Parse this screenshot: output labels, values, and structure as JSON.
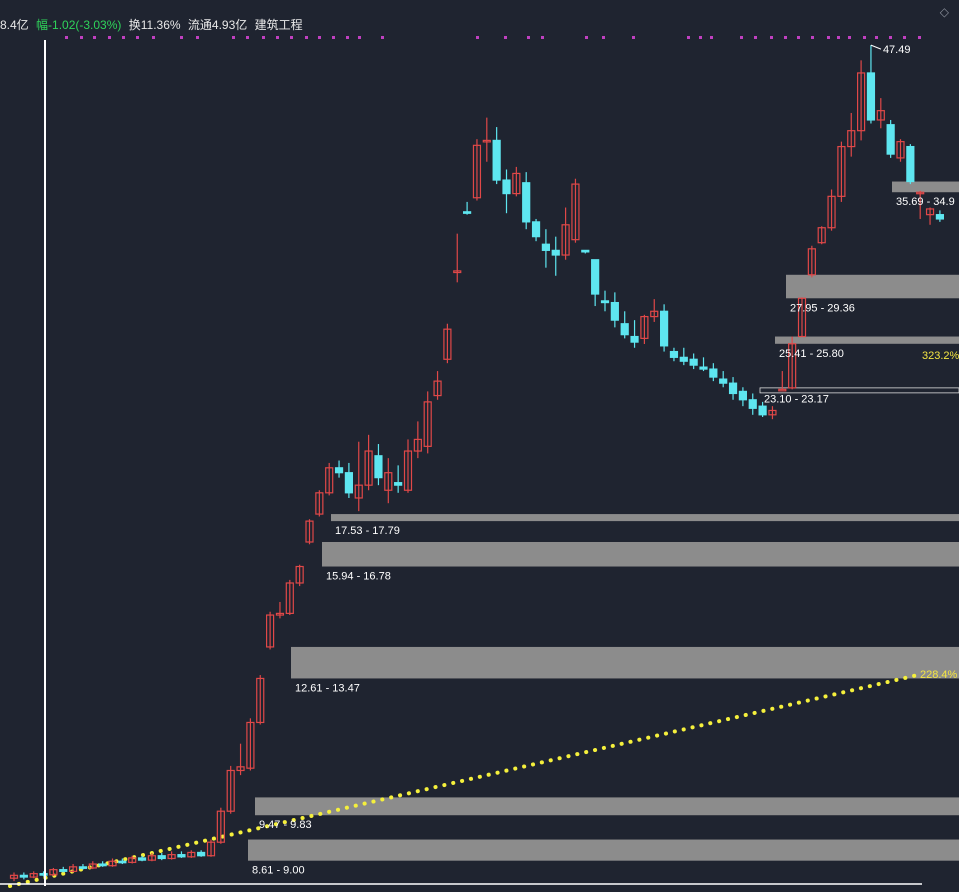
{
  "header": {
    "amount": "8.4亿",
    "change": "幅-1.02(-3.03%)",
    "turnover": "换11.36%",
    "float_cap": "流通4.93亿",
    "sector": "建筑工程",
    "change_color": "#2fd35a",
    "corner_icon": "diamond-icon"
  },
  "chart_data": {
    "type": "candlestick",
    "colors": {
      "up": "#e04848",
      "down": "#5ee6f0",
      "zone": "#8c8c8c",
      "trend": "#f5f03c",
      "marker": "#c040c0"
    },
    "y_log": true,
    "peak_label": "47.49",
    "zones": [
      {
        "label": "8.61 - 9.00",
        "low": 8.61,
        "high": 9.0
      },
      {
        "label": "9.47 - 9.83",
        "low": 9.47,
        "high": 9.83
      },
      {
        "label": "12.61 - 13.47",
        "low": 12.61,
        "high": 13.47
      },
      {
        "label": "15.94 - 16.78",
        "low": 15.94,
        "high": 16.78
      },
      {
        "label": "17.53 - 17.79",
        "low": 17.53,
        "high": 17.79
      },
      {
        "label": "23.10 - 23.17",
        "low": 23.1,
        "high": 23.17
      },
      {
        "label": "25.41 - 25.80",
        "low": 25.41,
        "high": 25.8
      },
      {
        "label": "27.95 - 29.36",
        "low": 27.95,
        "high": 29.36
      },
      {
        "label": "35.69 - 34.9",
        "low": 34.9,
        "high": 35.69
      }
    ],
    "trend_labels": [
      "228.4%",
      "323.2%"
    ],
    "candles": [
      [
        8.3,
        8.35,
        8.4,
        8.25
      ],
      [
        8.35,
        8.32,
        8.4,
        8.28
      ],
      [
        8.32,
        8.38,
        8.42,
        8.3
      ],
      [
        8.38,
        8.36,
        8.42,
        8.33
      ],
      [
        8.36,
        8.45,
        8.48,
        8.34
      ],
      [
        8.45,
        8.42,
        8.5,
        8.4
      ],
      [
        8.42,
        8.5,
        8.55,
        8.4
      ],
      [
        8.5,
        8.48,
        8.55,
        8.45
      ],
      [
        8.48,
        8.55,
        8.6,
        8.46
      ],
      [
        8.55,
        8.52,
        8.6,
        8.5
      ],
      [
        8.52,
        8.6,
        8.65,
        8.5
      ],
      [
        8.6,
        8.58,
        8.65,
        8.55
      ],
      [
        8.58,
        8.66,
        8.7,
        8.56
      ],
      [
        8.66,
        8.62,
        8.7,
        8.6
      ],
      [
        8.62,
        8.7,
        8.75,
        8.6
      ],
      [
        8.7,
        8.65,
        8.75,
        8.62
      ],
      [
        8.65,
        8.72,
        8.78,
        8.63
      ],
      [
        8.72,
        8.68,
        8.78,
        8.66
      ],
      [
        8.68,
        8.76,
        8.8,
        8.66
      ],
      [
        8.76,
        8.7,
        8.8,
        8.68
      ],
      [
        8.7,
        8.95,
        9.0,
        8.68
      ],
      [
        8.95,
        9.55,
        9.62,
        8.92
      ],
      [
        9.55,
        10.4,
        10.5,
        9.5
      ],
      [
        10.4,
        10.48,
        11.0,
        10.3
      ],
      [
        10.45,
        11.5,
        11.6,
        10.4
      ],
      [
        11.5,
        12.61,
        12.7,
        11.45
      ],
      [
        13.47,
        14.4,
        14.5,
        13.4
      ],
      [
        14.4,
        14.45,
        14.8,
        14.3
      ],
      [
        14.45,
        15.4,
        15.5,
        14.4
      ],
      [
        15.4,
        15.94,
        16.0,
        15.3
      ],
      [
        16.78,
        17.53,
        17.6,
        16.7
      ],
      [
        17.79,
        18.6,
        18.7,
        17.7
      ],
      [
        18.6,
        19.6,
        19.8,
        18.5
      ],
      [
        19.6,
        19.4,
        19.9,
        19.2
      ],
      [
        19.4,
        18.6,
        19.8,
        18.4
      ],
      [
        18.4,
        18.9,
        20.7,
        17.9
      ],
      [
        18.9,
        20.3,
        21.0,
        18.7
      ],
      [
        20.1,
        19.2,
        20.6,
        18.9
      ],
      [
        18.7,
        19.4,
        20.0,
        18.2
      ],
      [
        19.0,
        18.9,
        19.7,
        18.6
      ],
      [
        18.7,
        20.3,
        20.8,
        18.6
      ],
      [
        20.3,
        20.8,
        21.6,
        20.0
      ],
      [
        20.5,
        22.5,
        23.0,
        20.2
      ],
      [
        22.8,
        23.5,
        24.0,
        22.6
      ],
      [
        24.6,
        26.2,
        26.5,
        24.4
      ],
      [
        29.5,
        29.6,
        32.0,
        28.9
      ],
      [
        33.5,
        33.4,
        34.2,
        33.3
      ],
      [
        34.5,
        38.5,
        39.0,
        34.3
      ],
      [
        38.8,
        38.9,
        40.8,
        37.2
      ],
      [
        38.9,
        35.8,
        40.0,
        35.5
      ],
      [
        35.8,
        34.8,
        36.6,
        33.4
      ],
      [
        34.8,
        36.3,
        36.8,
        34.6
      ],
      [
        35.6,
        32.8,
        36.4,
        32.3
      ],
      [
        32.8,
        31.8,
        33.0,
        31.5
      ],
      [
        31.3,
        30.9,
        32.3,
        29.8
      ],
      [
        30.9,
        30.6,
        31.8,
        29.3
      ],
      [
        30.6,
        32.6,
        33.8,
        30.3
      ],
      [
        31.6,
        35.5,
        35.9,
        31.4
      ],
      [
        30.9,
        30.8,
        30.9,
        30.7
      ],
      [
        30.3,
        28.2,
        30.3,
        27.5
      ],
      [
        27.8,
        27.7,
        28.4,
        27.2
      ],
      [
        27.7,
        26.7,
        28.3,
        26.3
      ],
      [
        26.5,
        25.9,
        27.2,
        25.7
      ],
      [
        25.8,
        25.5,
        26.7,
        25.2
      ],
      [
        25.7,
        26.9,
        27.0,
        25.4
      ],
      [
        26.9,
        27.2,
        27.9,
        26.6
      ],
      [
        27.2,
        25.3,
        27.6,
        25.0
      ],
      [
        25.0,
        24.7,
        25.2,
        24.5
      ],
      [
        24.7,
        24.5,
        25.2,
        24.3
      ],
      [
        24.6,
        24.3,
        24.9,
        24.1
      ],
      [
        24.2,
        24.1,
        24.7,
        24.0
      ],
      [
        24.1,
        23.7,
        24.4,
        23.5
      ],
      [
        23.6,
        23.4,
        24.0,
        23.2
      ],
      [
        23.4,
        22.9,
        23.7,
        22.6
      ],
      [
        23.0,
        22.6,
        23.2,
        22.3
      ],
      [
        22.6,
        22.2,
        22.9,
        21.9
      ],
      [
        22.3,
        21.9,
        22.5,
        21.8
      ],
      [
        21.9,
        22.1,
        22.3,
        21.7
      ],
      [
        23.1,
        23.1,
        24.0,
        23.1
      ],
      [
        23.17,
        25.41,
        25.8,
        23.1
      ],
      [
        25.8,
        27.95,
        28.0,
        25.8
      ],
      [
        29.36,
        31.0,
        31.2,
        29.2
      ],
      [
        31.4,
        32.4,
        32.5,
        31.3
      ],
      [
        32.4,
        34.6,
        35.1,
        32.2
      ],
      [
        34.6,
        38.4,
        38.8,
        34.2
      ],
      [
        38.4,
        39.7,
        41.2,
        37.6
      ],
      [
        39.7,
        44.8,
        46.0,
        38.9
      ],
      [
        44.8,
        40.6,
        47.49,
        40.3
      ],
      [
        40.6,
        41.4,
        42.5,
        39.9
      ],
      [
        40.2,
        37.8,
        40.6,
        37.5
      ],
      [
        37.5,
        38.8,
        39.0,
        37.2
      ],
      [
        38.4,
        35.69,
        38.6,
        35.5
      ],
      [
        34.9,
        34.9,
        35.0,
        33.0
      ],
      [
        33.3,
        33.7,
        33.8,
        32.6
      ],
      [
        33.3,
        33.0,
        33.6,
        32.8
      ]
    ]
  }
}
